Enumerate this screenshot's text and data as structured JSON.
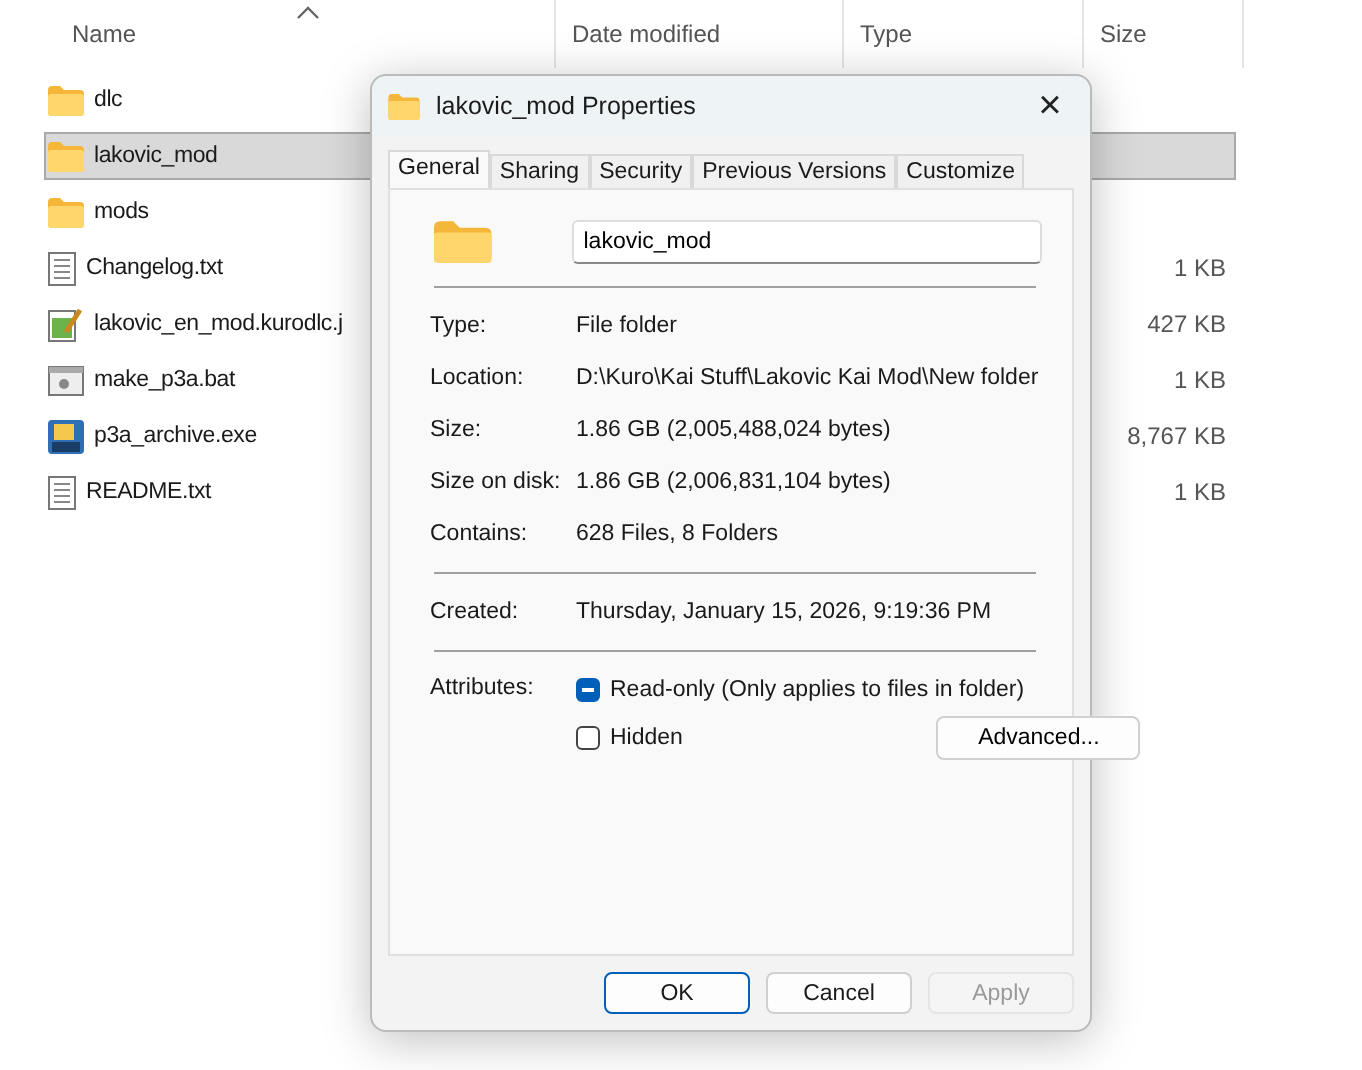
{
  "explorer": {
    "columns": [
      {
        "label": "Name",
        "sorted": true
      },
      {
        "label": "Date modified",
        "sorted": false
      },
      {
        "label": "Type",
        "sorted": false
      },
      {
        "label": "Size",
        "sorted": false
      }
    ],
    "rows": [
      {
        "name": "dlc",
        "kind": "folder",
        "selected": false
      },
      {
        "name": "lakovic_mod",
        "kind": "folder",
        "selected": true
      },
      {
        "name": "mods",
        "kind": "folder",
        "selected": false
      },
      {
        "name": "Changelog.txt",
        "kind": "text",
        "size": "1 KB",
        "selected": false
      },
      {
        "name": "lakovic_en_mod.kurodlc.j",
        "kind": "script",
        "size": "427 KB",
        "selected": false
      },
      {
        "name": "make_p3a.bat",
        "kind": "batch",
        "size": "1 KB",
        "selected": false
      },
      {
        "name": "p3a_archive.exe",
        "kind": "program",
        "size": "8,767 KB",
        "selected": false
      },
      {
        "name": "README.txt",
        "kind": "text",
        "size": "1 KB",
        "selected": false
      }
    ]
  },
  "dialog": {
    "title": "lakovic_mod Properties",
    "close": "×",
    "tabs": [
      {
        "label": "General",
        "selected": true
      },
      {
        "label": "Sharing",
        "selected": false
      },
      {
        "label": "Security",
        "selected": false
      },
      {
        "label": "Previous Versions",
        "selected": false
      },
      {
        "label": "Customize",
        "selected": false
      }
    ],
    "name_value": "lakovic_mod",
    "groups": [
      [
        {
          "label": "Type:",
          "value": "File folder"
        },
        {
          "label": "Location:",
          "value": "D:\\Kuro\\Kai Stuff\\Lakovic Kai Mod\\New folder"
        },
        {
          "label": "Size:",
          "value": "1.86 GB (2,005,488,024 bytes)"
        },
        {
          "label": "Size on disk:",
          "value": "1.86 GB (2,006,831,104 bytes)"
        },
        {
          "label": "Contains:",
          "value": "628 Files, 8 Folders"
        }
      ],
      [
        {
          "label": "Created:",
          "value": "Thursday, January 15, 2026, 9:19:36 PM"
        }
      ]
    ],
    "attributes_label": "Attributes:",
    "attributes": [
      {
        "label": "Read-only (Only applies to files in folder)",
        "indeterminate": true
      },
      {
        "label": "Hidden",
        "checked": false
      }
    ],
    "advanced": "Advanced...",
    "buttons": [
      {
        "label": "OK",
        "default": true,
        "disabled": false
      },
      {
        "label": "Cancel",
        "default": false,
        "disabled": false
      },
      {
        "label": "Apply",
        "default": false,
        "disabled": true
      }
    ]
  }
}
